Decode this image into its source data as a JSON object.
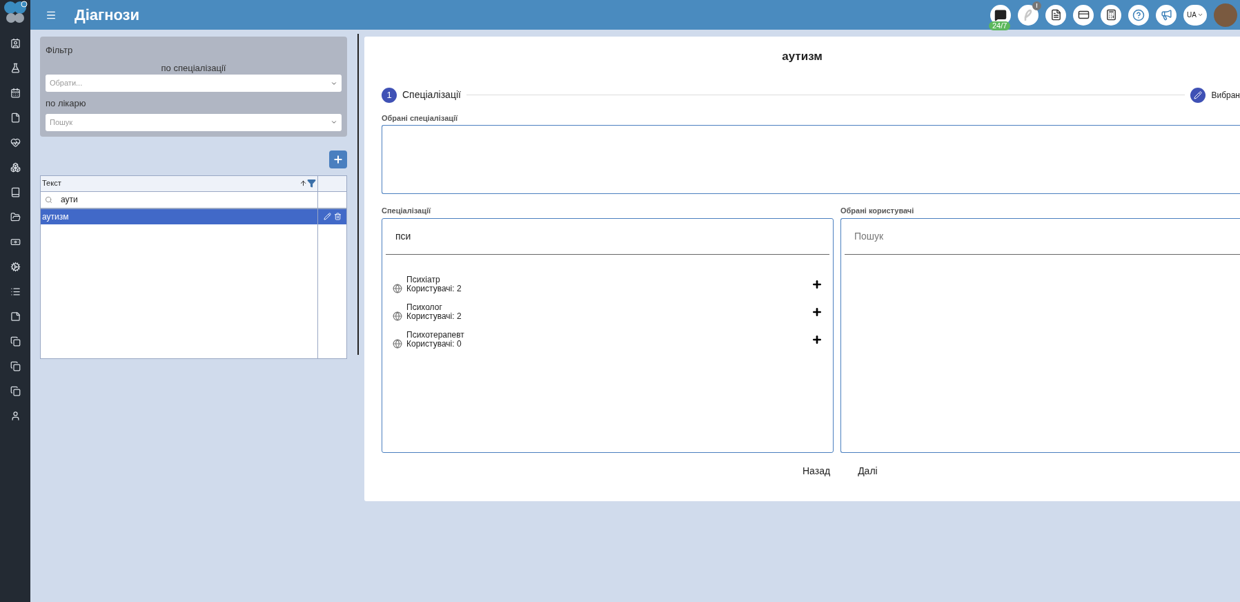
{
  "app": {
    "title": "Діагнози"
  },
  "topbar": {
    "chat_badge": "24/7",
    "notice_badge": "!",
    "language": "UA"
  },
  "filter": {
    "title": "Фільтр",
    "specialization_label": "по спеціалізації",
    "specialization_placeholder": "Обрати...",
    "doctor_label": "по лікарю",
    "doctor_placeholder": "Пошук"
  },
  "table": {
    "columns": [
      {
        "label": "Текст"
      }
    ],
    "search_value": "аути",
    "rows": [
      {
        "text": "аутизм",
        "selected": true
      }
    ]
  },
  "editor": {
    "title": "аутизм",
    "steps": [
      {
        "kind": "number",
        "number": "1",
        "label": "Спеціалізації"
      },
      {
        "kind": "edit",
        "label": "Вибран"
      }
    ],
    "selected_label": "Обрані спеціалізації",
    "specializations": {
      "label": "Спеціалізації",
      "search_value": "пси",
      "items": [
        {
          "name": "Психіатр",
          "users": "Користувачі: 2"
        },
        {
          "name": "Психолог",
          "users": "Користувачі: 2"
        },
        {
          "name": "Психотерапевт",
          "users": "Користувачі: 0"
        }
      ]
    },
    "users": {
      "label": "Обрані користувачі",
      "placeholder": "Пошук"
    },
    "buttons": [
      "Назад",
      "Далі"
    ]
  }
}
